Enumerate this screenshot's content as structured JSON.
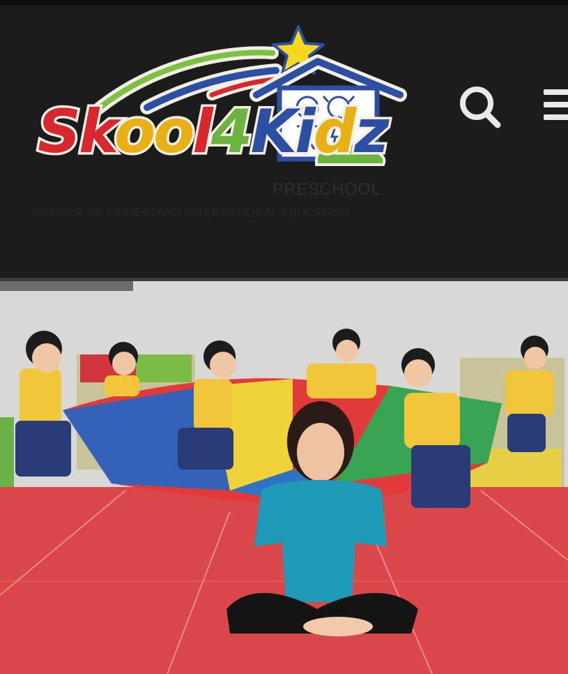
{
  "header": {
    "logo": {
      "wordmark": "Skool4Kidz",
      "subtitle": "PRESCHOOL",
      "tagline": "MEMBER OF KINDERLAND INTERNATIONAL EDUCATION"
    },
    "icons": {
      "search": "search-icon",
      "menu": "hamburger-menu-icon"
    }
  },
  "hero": {
    "image": "teacher sitting cross-legged on red floor with children playing with a parachute"
  },
  "colors": {
    "header_bg": "#1c1c1c",
    "brand_red": "#d8272f",
    "brand_yellow": "#e8b015",
    "brand_green": "#6db33f",
    "brand_blue": "#2c4ea3",
    "floor_red": "#d9474a"
  }
}
